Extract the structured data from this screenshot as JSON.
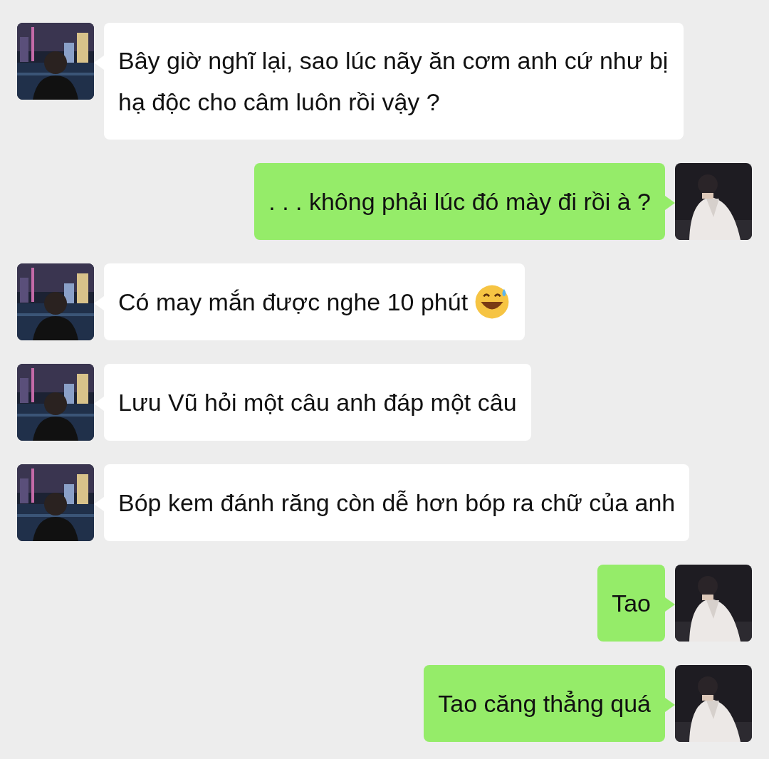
{
  "messages": [
    {
      "kind": "received",
      "text": "Bây giờ nghĩ lại, sao lúc nãy ăn cơm anh cứ như bị hạ độc cho câm luôn rồi vậy ?",
      "emoji_after": false
    },
    {
      "kind": "sent",
      "text": ". . . không phải lúc đó mày đi rồi à ?",
      "emoji_after": false
    },
    {
      "kind": "received",
      "text": "Có may mắn được nghe 10 phút",
      "emoji_after": true
    },
    {
      "kind": "received",
      "text": "Lưu Vũ hỏi một câu anh đáp một câu",
      "emoji_after": false
    },
    {
      "kind": "received",
      "text": "Bóp kem đánh răng còn dễ hơn bóp ra chữ của anh",
      "emoji_after": false
    },
    {
      "kind": "sent",
      "text": "Tao",
      "emoji_after": false
    },
    {
      "kind": "sent",
      "text": "Tao căng thẳng quá",
      "emoji_after": false
    }
  ]
}
